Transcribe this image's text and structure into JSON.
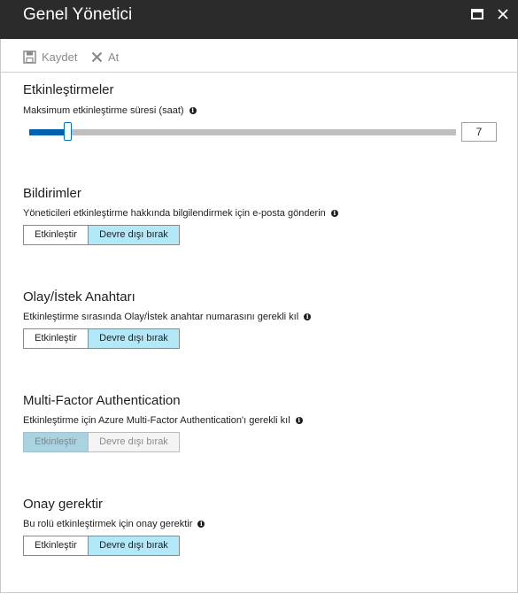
{
  "window": {
    "title": "Genel Yönetici"
  },
  "toolbar": {
    "save_label": "Kaydet",
    "discard_label": "At"
  },
  "activations": {
    "title": "Etkinleştirmeler",
    "max_duration_label": "Maksimum etkinleştirme süresi (saat)",
    "max_duration_value": "7",
    "slider_fraction": 0.09
  },
  "notifications": {
    "title": "Bildirimler",
    "description": "Yöneticileri etkinleştirme hakkında bilgilendirmek için e-posta gönderin",
    "enable_label": "Etkinleştir",
    "disable_label": "Devre dışı bırak",
    "selected": "disable"
  },
  "incident": {
    "title": "Olay/İstek Anahtarı",
    "description": "Etkinleştirme sırasında Olay/İstek anahtar numarasını gerekli kıl",
    "enable_label": "Etkinleştir",
    "disable_label": "Devre dışı bırak",
    "selected": "disable"
  },
  "mfa": {
    "title": "Multi-Factor Authentication",
    "description": "Etkinleştirme için Azure Multi-Factor Authentication'ı gerekli kıl",
    "enable_label": "Etkinleştir",
    "disable_label": "Devre dışı bırak",
    "selected": "enable",
    "disabled": true
  },
  "approval": {
    "title": "Onay gerektir",
    "description": "Bu rolü etkinleştirmek için onay gerektir",
    "enable_label": "Etkinleştir",
    "disable_label": "Devre dışı bırak",
    "selected": "disable"
  },
  "colors": {
    "header_bg": "#2b2b2b",
    "accent": "#0063b1",
    "selected_toggle": "#b3e8f9"
  }
}
